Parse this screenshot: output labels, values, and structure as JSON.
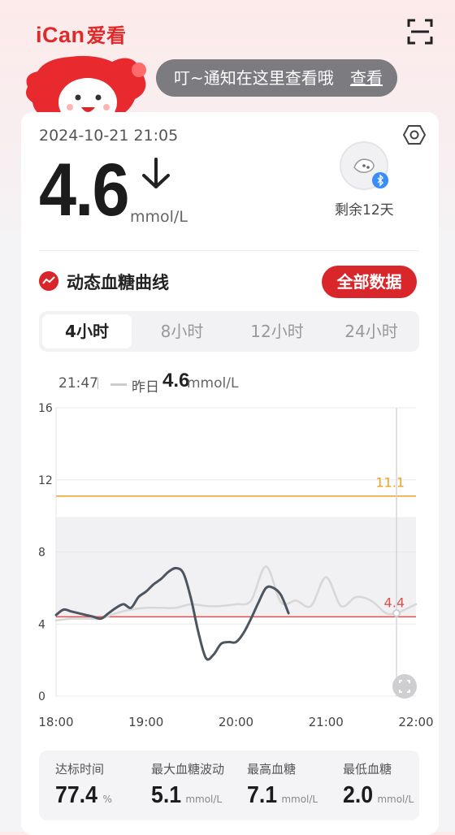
{
  "header": {
    "logo_latin": "iCan",
    "logo_cn": "爱看",
    "notice_text": "叮~通知在这里查看哦",
    "notice_link": "查看"
  },
  "reading": {
    "datetime": "2024-10-21 21:05",
    "value": "4.6",
    "unit": "mmol/L",
    "trend": "arrow-down",
    "sensor_remaining": "剩余12天"
  },
  "curve": {
    "title": "动态血糖曲线",
    "all_data_button": "全部数据",
    "tabs": [
      "4小时",
      "8小时",
      "12小时",
      "24小时"
    ],
    "active_tab": 0
  },
  "legend": {
    "time": "21:47",
    "label": "昨日",
    "value": "4.6",
    "unit": "mmol/L"
  },
  "chart_data": {
    "type": "line",
    "ylim": [
      0,
      16
    ],
    "yticks": [
      "16",
      "12",
      "8",
      "4",
      "0"
    ],
    "xticks": [
      "18:00",
      "19:00",
      "20:00",
      "21:00",
      "22:00"
    ],
    "x_domain": [
      "18:00",
      "22:00"
    ],
    "target_range": [
      4.4,
      11.1
    ],
    "high_line": {
      "value": 11.1,
      "label": "11.1",
      "color": "#f0a020"
    },
    "low_line": {
      "value": 4.4,
      "label": "4.4",
      "color": "#e05050"
    },
    "cursor_time": "21:47",
    "series": [
      {
        "color": "#4d5560",
        "x": [
          "18:00",
          "18:05",
          "18:10",
          "18:15",
          "18:20",
          "18:25",
          "18:30",
          "18:35",
          "18:40",
          "18:45",
          "18:50",
          "18:55",
          "19:00",
          "19:05",
          "19:10",
          "19:15",
          "19:20",
          "19:25",
          "19:30",
          "19:35",
          "19:40",
          "19:45",
          "19:50",
          "19:55",
          "20:00",
          "20:05",
          "20:10",
          "20:15",
          "20:20",
          "20:25",
          "20:30",
          "20:35",
          "20:40",
          "20:45",
          "20:50",
          "20:55",
          "21:00",
          "21:05"
        ],
        "values": [
          4.5,
          4.8,
          4.7,
          4.6,
          4.5,
          4.4,
          4.3,
          4.6,
          4.9,
          5.1,
          4.9,
          5.5,
          5.8,
          6.2,
          6.5,
          6.9,
          7.1,
          6.8,
          5.4,
          3.5,
          2.1,
          2.3,
          2.9,
          3.0,
          3.0,
          3.5,
          4.3,
          5.2,
          6.0,
          6.0,
          5.6,
          4.6,
          null,
          null,
          null,
          null,
          null,
          null
        ]
      },
      {
        "color": "#d7d7d7",
        "x": [
          "18:00",
          "18:10",
          "18:20",
          "18:30",
          "18:40",
          "18:50",
          "19:00",
          "19:10",
          "19:20",
          "19:30",
          "19:40",
          "19:50",
          "20:00",
          "20:10",
          "20:20",
          "20:30",
          "20:40",
          "20:50",
          "21:00",
          "21:10",
          "21:20",
          "21:30",
          "21:40",
          "21:47",
          "21:50",
          "22:00"
        ],
        "values": [
          4.2,
          4.3,
          4.3,
          4.3,
          4.6,
          4.8,
          4.9,
          4.9,
          4.9,
          5.1,
          5.0,
          5.0,
          5.1,
          5.3,
          7.2,
          5.2,
          5.3,
          5.0,
          6.6,
          5.0,
          5.5,
          5.3,
          4.6,
          4.6,
          4.7,
          5.1
        ]
      }
    ]
  },
  "stats": [
    {
      "label": "达标时间",
      "value": "77.4",
      "unit": "%"
    },
    {
      "label": "最大血糖波动",
      "value": "5.1",
      "unit": "mmol/L"
    },
    {
      "label": "最高血糖",
      "value": "7.1",
      "unit": "mmol/L"
    },
    {
      "label": "最低血糖",
      "value": "2.0",
      "unit": "mmol/L"
    }
  ],
  "colors": {
    "brand": "#d9262b",
    "notice_bg": "#7c7c80",
    "bluetooth": "#3a8ef6"
  }
}
